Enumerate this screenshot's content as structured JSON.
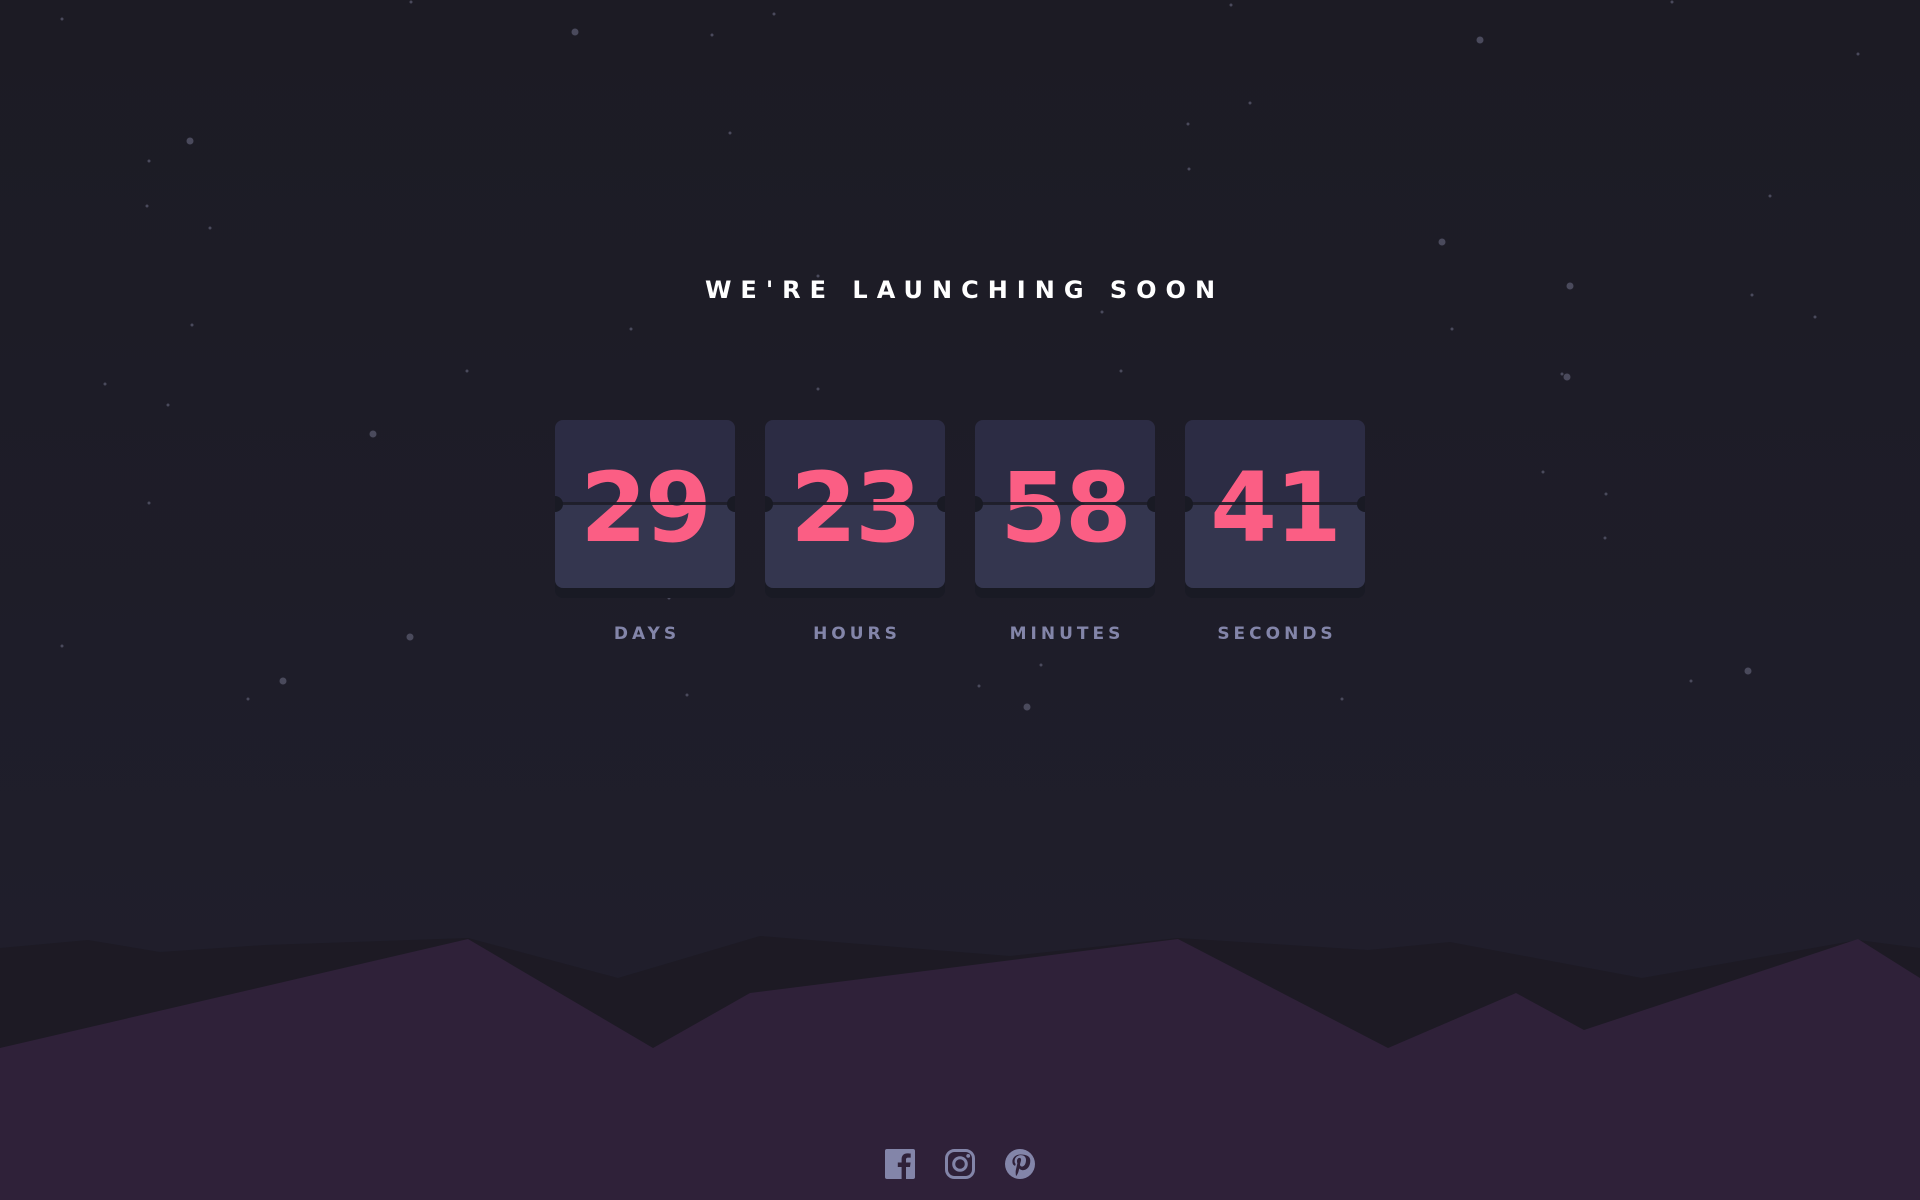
{
  "headline": "WE'RE LAUNCHING SOON",
  "countdown": [
    {
      "value": "29",
      "label": "DAYS"
    },
    {
      "value": "23",
      "label": "HOURS"
    },
    {
      "value": "58",
      "label": "MINUTES"
    },
    {
      "value": "41",
      "label": "SECONDS"
    }
  ],
  "social_links": [
    {
      "icon": "facebook-icon"
    },
    {
      "icon": "instagram-icon"
    },
    {
      "icon": "pinterest-icon"
    }
  ],
  "colors": {
    "background": "#1e1d29",
    "card_top": "#2c2c44",
    "card_bottom": "#34364f",
    "digits": "#fb5e84",
    "labels": "#8385a9",
    "headline": "#ffffff",
    "hills": "#2f2139",
    "icons": "#8385a9"
  }
}
